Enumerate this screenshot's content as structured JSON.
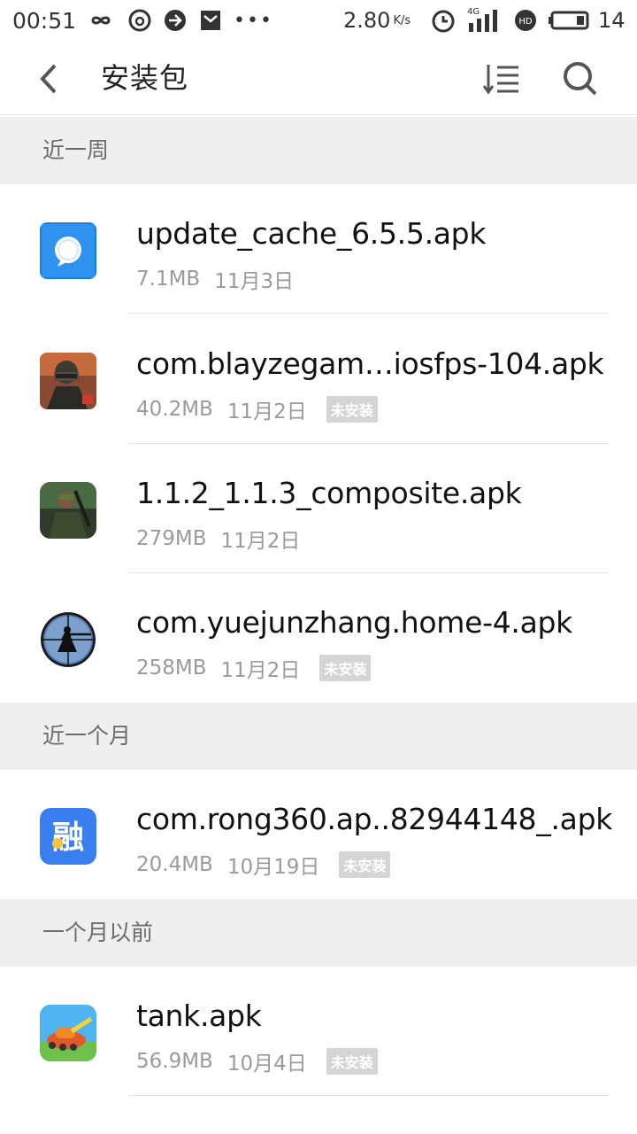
{
  "status_bar": {
    "time": "00:51",
    "speed": "2.80",
    "speed_unit": "K/s",
    "network": "4G",
    "battery": "14"
  },
  "app_bar": {
    "title": "安装包"
  },
  "sections": [
    {
      "header": "近一周",
      "items": [
        {
          "name": "update_cache_6.5.5.apk",
          "size": "7.1MB",
          "date": "11月3日",
          "badge": "",
          "icon": "blue-bubble-app-icon"
        },
        {
          "name": "com.blayzegam…iosfps-104.apk",
          "size": "40.2MB",
          "date": "11月2日",
          "badge": "未安装",
          "icon": "soldier-game-icon"
        },
        {
          "name": "1.1.2_1.1.3_composite.apk",
          "size": "279MB",
          "date": "11月2日",
          "badge": "",
          "icon": "survival-game-icon"
        },
        {
          "name": "com.yuejunzhang.home-4.apk",
          "size": "258MB",
          "date": "11月2日",
          "badge": "未安装",
          "icon": "sniper-scope-icon"
        }
      ]
    },
    {
      "header": "近一个月",
      "items": [
        {
          "name": "com.rong360.ap..82944148_.apk",
          "size": "20.4MB",
          "date": "10月19日",
          "badge": "未安装",
          "icon": "rong-finance-icon"
        }
      ]
    },
    {
      "header": "一个月以前",
      "items": [
        {
          "name": "tank.apk",
          "size": "56.9MB",
          "date": "10月4日",
          "badge": "未安装",
          "icon": "tank-game-icon"
        }
      ]
    }
  ],
  "colors": {
    "section_bg": "#efefef",
    "badge_bg": "#d5d5d5",
    "meta_text": "#9a9a9a"
  }
}
